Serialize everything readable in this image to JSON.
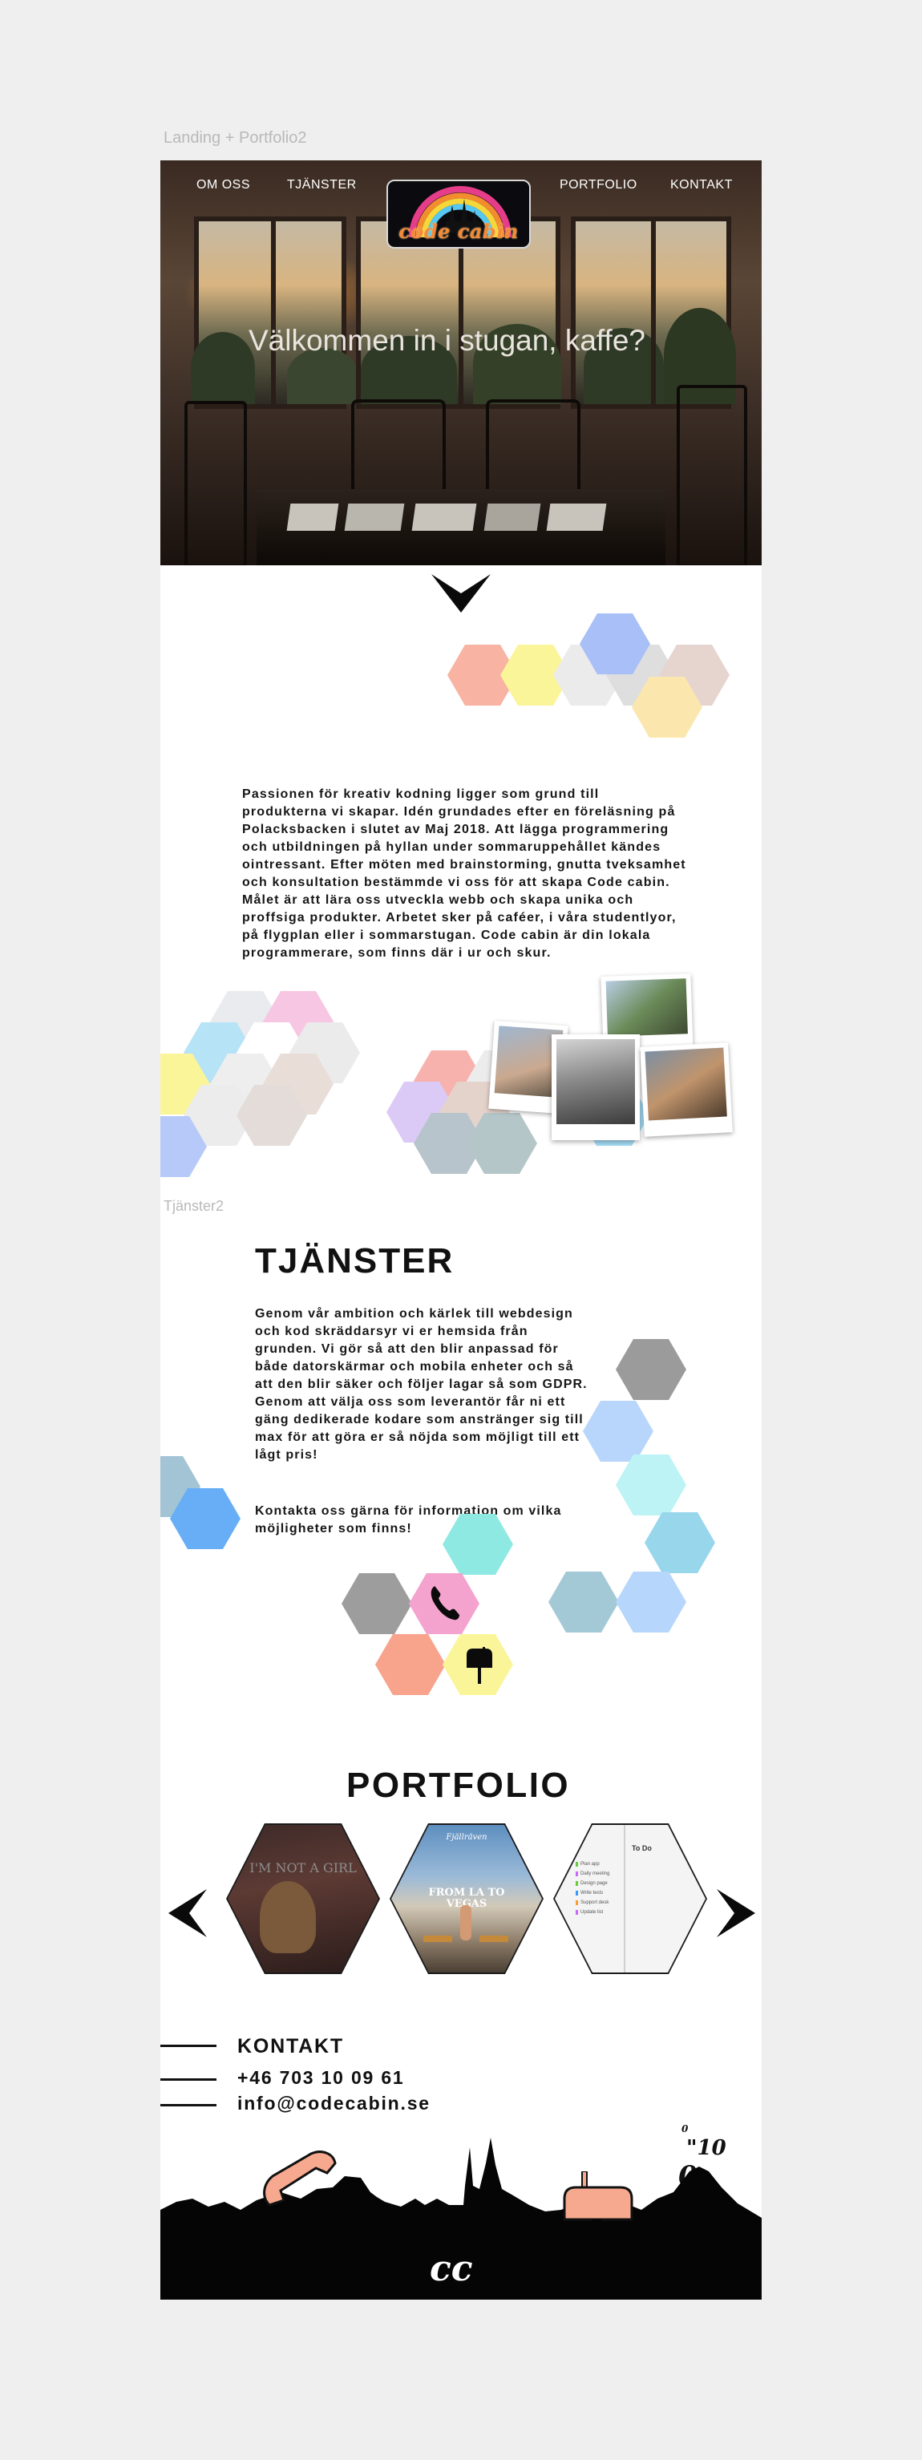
{
  "frames": {
    "landing_label": "Landing + Portfolio2",
    "services_label": "Tjänster2"
  },
  "nav": {
    "about": "OM OSS",
    "services": "TJÄNSTER",
    "portfolio": "PORTFOLIO",
    "contact": "KONTAKT"
  },
  "logo": {
    "text": "code cabin"
  },
  "hero": {
    "title": "Välkommen in i stugan, kaffe?"
  },
  "about": {
    "text": "Passionen för kreativ kodning ligger som grund till produkterna vi skapar. Idén grundades efter en föreläsning på Polacksbacken i slutet av Maj 2018. Att lägga programmering och utbildningen på hyllan under sommaruppehållet kändes ointressant. Efter möten med brainstorming, gnutta tveksamhet och konsultation bestämmde vi oss för att skapa Code cabin. Målet är att lära oss utveckla webb och skapa unika och proffsiga produkter. Arbetet sker på caféer, i våra studentlyor, på flygplan eller i sommarstugan. Code cabin är din lokala programmerare, som finns där i ur och skur."
  },
  "services": {
    "title": "TJÄNSTER",
    "text": "Genom vår ambition och kärlek till webdesign och kod skräddarsyr vi er hemsida från grunden. Vi gör så att den blir anpassad för både datorskärmar och mobila enheter och så att den blir säker och följer lagar så som GDPR. Genom att välja oss som leverantör får ni ett gäng dedikerade kodare som anstränger sig till max för att göra er så nöjda som möjligt till ett lågt pris!",
    "contact_text": "Kontakta oss gärna för information om vilka möjligheter som finns!"
  },
  "portfolio": {
    "title": "PORTFOLIO",
    "items": [
      {
        "label": "I'M NOT A GIRL"
      },
      {
        "label": "FROM LA TO VEGAS",
        "brand": "Fjällräven"
      },
      {
        "label": "To Do",
        "rows": [
          "Plan app",
          "Daily meeting",
          "Design page",
          "Write tests",
          "Support desk",
          "Update list"
        ]
      }
    ]
  },
  "contact": {
    "title": "KONTAKT",
    "phone": "+46 703 10 09 61",
    "email": "info@codecabin.se"
  },
  "footer": {
    "logo": "cc",
    "binary": [
      "0",
      "\"10",
      "0",
      "1"
    ]
  },
  "colors": {
    "background": "#efefef",
    "artboard": "#ffffff",
    "ink": "#111111",
    "salmon": "#f6a98f",
    "yellow": "#fbf59a",
    "pink": "#f7bfe0",
    "blue": "#9db8f7"
  }
}
